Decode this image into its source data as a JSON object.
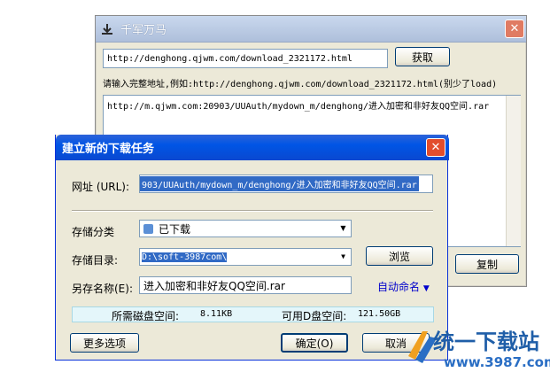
{
  "bg_window": {
    "title": "千军万马",
    "url_value": "http://denghong.qjwm.com/download_2321172.html",
    "fetch_button": "获取",
    "hint": "请输入完整地址,例如:http://denghong.qjwm.com/download_2321172.html(别少了load)",
    "result_text": "http://m.qjwm.com:20903/UUAuth/mydown_m/denghong/进入加密和非好友QQ空间.rar",
    "copy_button": "复制"
  },
  "dialog": {
    "title": "建立新的下载任务",
    "url_label": "网址 (URL):",
    "url_value": "903/UUAuth/mydown_m/denghong/进入加密和非好友QQ空间.rar",
    "category_label": "存储分类",
    "category_value": "已下载",
    "dir_label": "存储目录:",
    "dir_value": "D:\\soft-3987com\\",
    "browse_button": "浏览",
    "saveas_label": "另存名称(E):",
    "saveas_value": "进入加密和非好友QQ空间.rar",
    "auto_name_link": "自动命名",
    "disk_needed_label": "所需磁盘空间:",
    "disk_needed_value": "8.11KB",
    "disk_free_label": "可用D盘空间:",
    "disk_free_value": "121.50GB",
    "more_button": "更多选项",
    "ok_button": "确定(O)",
    "cancel_button": "取消"
  },
  "watermark": {
    "brand": "统一下载站",
    "url": "www.3987.com"
  },
  "colors": {
    "dialog_title_bg": "#0055e5",
    "window_bg": "#ece9d8",
    "link": "#0000cc"
  }
}
